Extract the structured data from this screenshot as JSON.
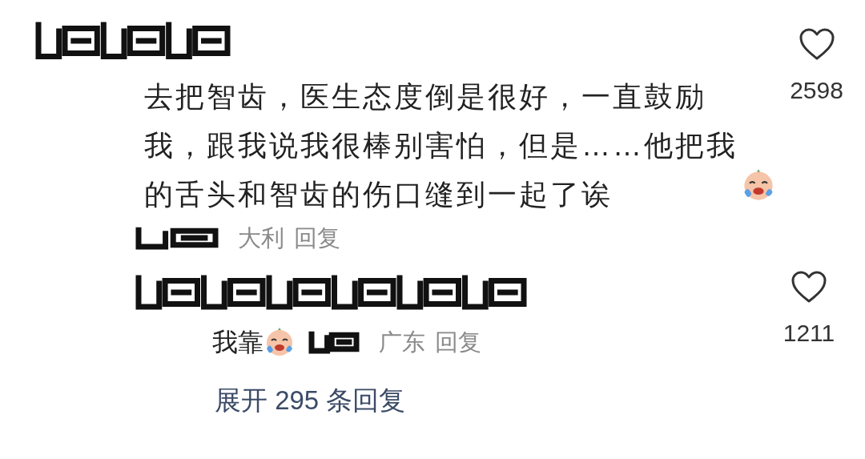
{
  "comments": [
    {
      "body": "去把智齿，医生态度倒是很好，一直鼓励我，跟我说我很棒别害怕，但是……他把我的舌头和智齿的伤口缝到一起了诶",
      "meta": {
        "location": "大利",
        "reply": "回复"
      },
      "likes": "2598"
    },
    {
      "meta": {
        "text": "我靠",
        "location": "广东",
        "reply": "回复"
      },
      "likes": "1211"
    }
  ],
  "expand_replies": "展开 295 条回复"
}
